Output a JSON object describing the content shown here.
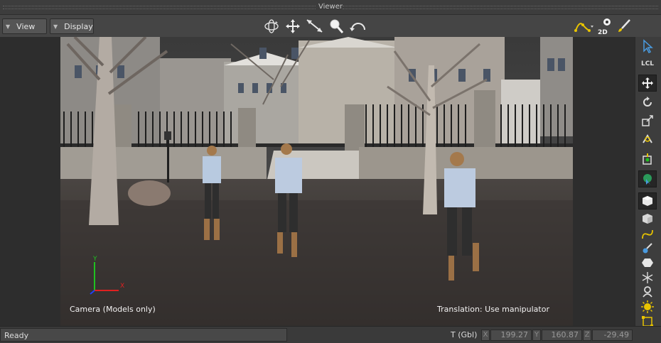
{
  "window": {
    "title": "Viewer"
  },
  "toolbar": {
    "view_label": "View",
    "display_label": "Display",
    "icons": [
      "orbit-icon",
      "pan-icon",
      "dolly-icon",
      "zoom-icon",
      "undo-camera-icon",
      "fcurve-icon",
      "2d-view-icon",
      "paint-icon"
    ],
    "two_d_label": "2D"
  },
  "viewport": {
    "camera_label": "Camera (Models only)",
    "translation_label": "Translation: Use manipulator",
    "axis_x": "X",
    "axis_y": "Y"
  },
  "right_tools": {
    "lcl_label": "LCL",
    "icons": [
      "select-icon",
      "local-icon",
      "translate-icon",
      "rotate-icon",
      "scale-icon",
      "magnet-icon",
      "pivot-icon",
      "globe-select-icon",
      "cube-icon",
      "cube-icon-2",
      "curve-icon",
      "paint-brush-icon",
      "hexagon-icon",
      "joint-icon",
      "link-icon",
      "light-icon",
      "frame-icon"
    ]
  },
  "status": {
    "ready": "Ready",
    "transform_label": "T (Gbl)",
    "x_label": "X",
    "x_value": "199.27",
    "y_label": "Y",
    "y_value": "160.87",
    "z_label": "Z",
    "z_value": "-29.49"
  },
  "colors": {
    "accent_yellow": "#e8c400",
    "axis_x": "#e02020",
    "axis_y": "#20c020",
    "axis_z": "#2040ff",
    "select_blue": "#4a9be0"
  }
}
